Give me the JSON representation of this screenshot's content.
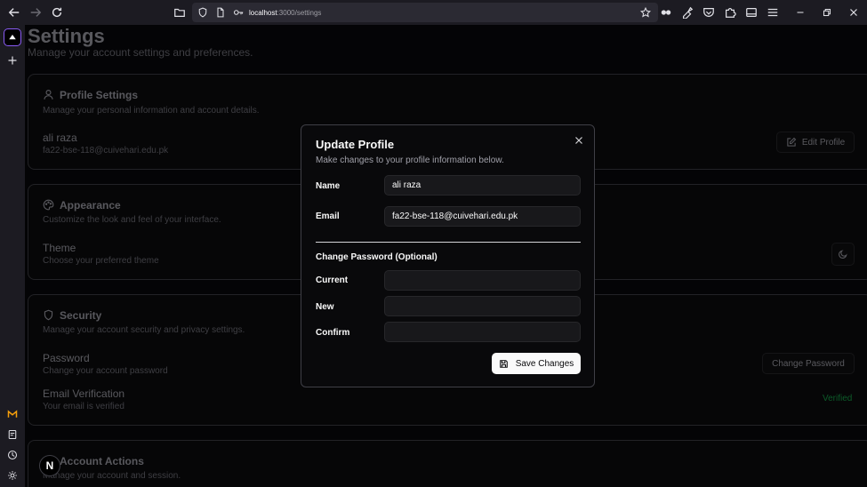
{
  "browser": {
    "url_host": "localhost",
    "url_path": ":3000/settings"
  },
  "page": {
    "title": "Settings",
    "subtitle": "Manage your account settings and preferences."
  },
  "profile": {
    "title": "Profile Settings",
    "desc": "Manage your personal information and account details.",
    "name": "ali raza",
    "email": "fa22-bse-118@cuivehari.edu.pk",
    "edit_label": "Edit Profile"
  },
  "appearance": {
    "title": "Appearance",
    "desc": "Customize the look and feel of your interface.",
    "theme_label": "Theme",
    "theme_desc": "Choose your preferred theme"
  },
  "security": {
    "title": "Security",
    "desc": "Manage your account security and privacy settings.",
    "password_label": "Password",
    "password_desc": "Change your account password",
    "change_password_label": "Change Password",
    "email_verif_label": "Email Verification",
    "email_verif_desc": "Your email is verified",
    "verified_label": "Verified",
    "verified_color": "#16a34a"
  },
  "account": {
    "title": "Account Actions",
    "desc": "Manage your account and session."
  },
  "modal": {
    "title": "Update Profile",
    "subtitle": "Make changes to your profile information below.",
    "name_label": "Name",
    "name_value": "ali raza",
    "email_label": "Email",
    "email_value": "fa22-bse-118@cuivehari.edu.pk",
    "password_section": "Change Password (Optional)",
    "current_label": "Current",
    "new_label": "New",
    "confirm_label": "Confirm",
    "save_label": "Save Changes"
  },
  "next_badge": "N",
  "accent_color": "#8a5cf5"
}
